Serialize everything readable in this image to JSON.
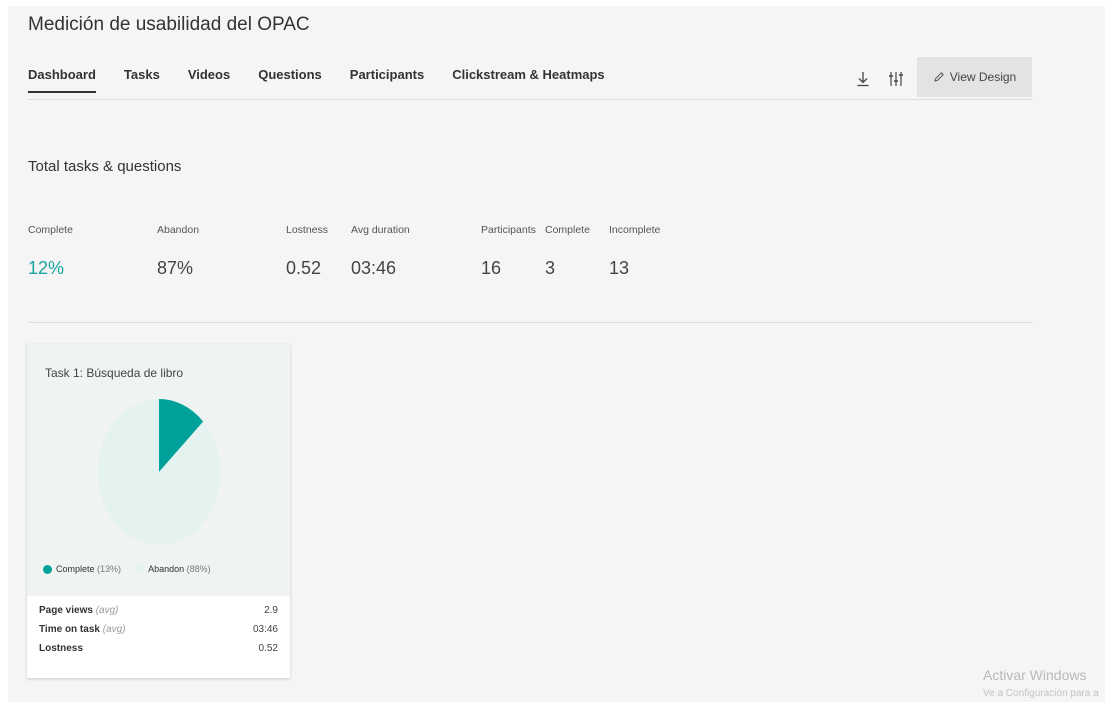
{
  "header": {
    "title": "Medición de usabilidad del OPAC",
    "tabs": [
      {
        "label": "Dashboard",
        "active": true
      },
      {
        "label": "Tasks"
      },
      {
        "label": "Videos"
      },
      {
        "label": "Questions"
      },
      {
        "label": "Participants"
      },
      {
        "label": "Clickstream & Heatmaps"
      }
    ],
    "tools": {
      "download_icon": "download-icon",
      "settings_icon": "sliders-icon"
    },
    "view_design_label": "View Design"
  },
  "summary": {
    "title": "Total tasks & questions",
    "metrics": [
      {
        "label": "Complete",
        "value": "12%"
      },
      {
        "label": "Abandon",
        "value": "87%"
      },
      {
        "label": "Lostness",
        "value": "0.52"
      },
      {
        "label": "Avg duration",
        "value": "03:46"
      },
      {
        "label": "Participants",
        "value": "16"
      },
      {
        "label": "Complete",
        "value": "3"
      },
      {
        "label": "Incomplete",
        "value": "13"
      }
    ],
    "accent_color": "#1aa4a0"
  },
  "task_card": {
    "title": "Task 1: Búsqueda de libro",
    "legend": [
      {
        "name": "Complete",
        "pct": "(13%)",
        "color": "#00a19a"
      },
      {
        "name": "Abandon",
        "pct": "(88%)",
        "color": "#e4f2f0"
      }
    ],
    "rows": [
      {
        "label": "Page views",
        "qual": "(avg)",
        "value": "2.9"
      },
      {
        "label": "Time on task",
        "qual": "(avg)",
        "value": "03:46"
      },
      {
        "label": "Lostness",
        "qual": "",
        "value": "0.52"
      }
    ]
  },
  "chart_data": {
    "type": "pie",
    "categories": [
      "Complete",
      "Abandon"
    ],
    "values": [
      13,
      88
    ],
    "colors": [
      "#00a19a",
      "#e4f2f0"
    ],
    "title": "Task 1: Búsqueda de libro"
  },
  "watermark": {
    "line1": "Activar Windows",
    "line2": "Ve a Configuración para a"
  }
}
